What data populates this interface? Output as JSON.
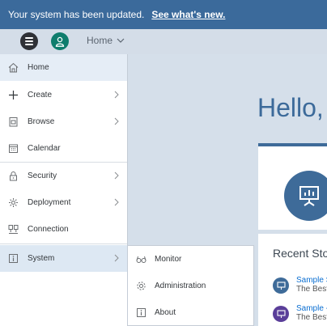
{
  "banner": {
    "message": "Your system has been updated.",
    "link": "See what's new."
  },
  "shellbar": {
    "breadcrumb": "Home"
  },
  "content": {
    "greeting": "Hello,",
    "recent": {
      "title": "Recent Sto",
      "items": [
        {
          "title": "Sample S",
          "subtitle": "The Best",
          "color": "#3e6b99"
        },
        {
          "title": "Sample -",
          "subtitle": "The Best",
          "color": "#5a3e99"
        }
      ]
    }
  },
  "menu": {
    "items": [
      {
        "label": "Home",
        "icon": "home-icon",
        "has_submenu": false
      },
      {
        "label": "Create",
        "icon": "plus-icon",
        "has_submenu": true
      },
      {
        "label": "Browse",
        "icon": "browse-icon",
        "has_submenu": true
      },
      {
        "label": "Calendar",
        "icon": "calendar-icon",
        "has_submenu": false
      },
      {
        "label": "Security",
        "icon": "lock-icon",
        "has_submenu": true
      },
      {
        "label": "Deployment",
        "icon": "deployment-icon",
        "has_submenu": true
      },
      {
        "label": "Connection",
        "icon": "connection-icon",
        "has_submenu": false
      },
      {
        "label": "System",
        "icon": "info-icon",
        "has_submenu": true
      }
    ],
    "active": "Home",
    "expanded": "System"
  },
  "submenu": {
    "items": [
      {
        "label": "Monitor",
        "icon": "glasses-icon"
      },
      {
        "label": "Administration",
        "icon": "gear-icon"
      },
      {
        "label": "About",
        "icon": "info-icon"
      }
    ]
  },
  "colors": {
    "banner": "#3b6a9b",
    "accent": "#3e6b99",
    "avatar": "#0f7d6d",
    "menu_active": "#e5edf6"
  }
}
